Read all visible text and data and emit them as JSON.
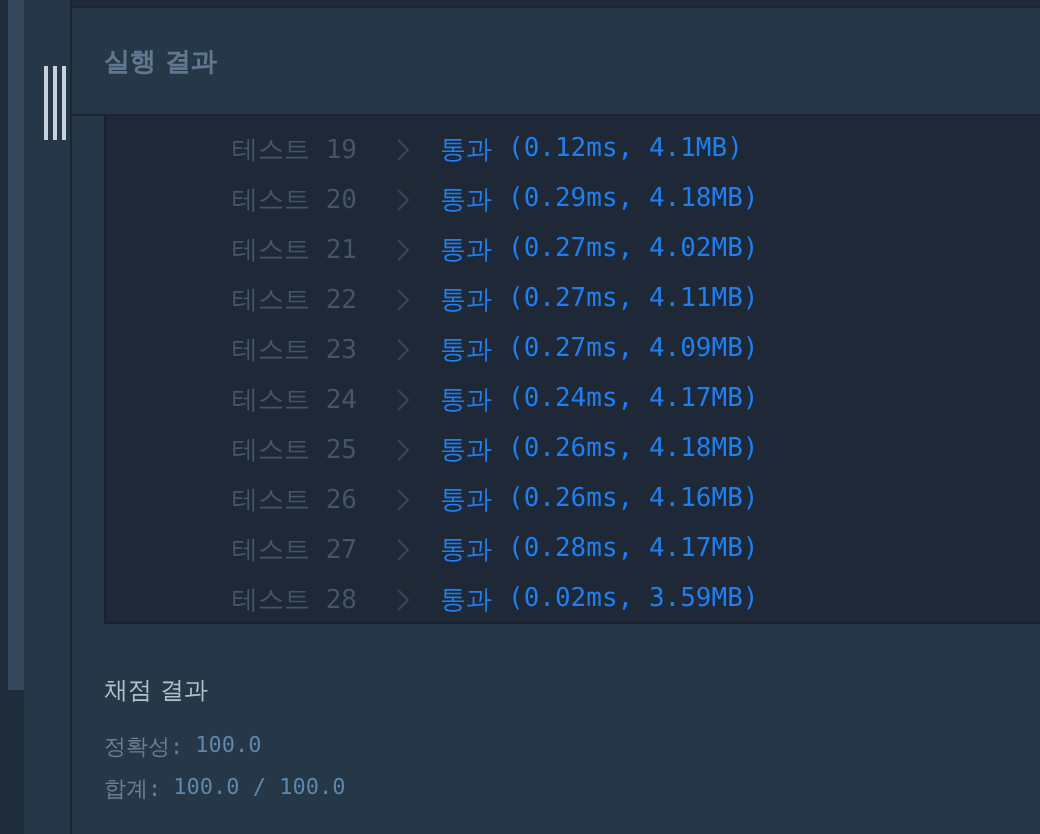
{
  "panel": {
    "title": "실행 결과"
  },
  "tests": [
    {
      "label": "테스트 19",
      "status": "통과",
      "detail": "(0.12ms, 4.1MB)",
      "passed": true
    },
    {
      "label": "테스트 20",
      "status": "통과",
      "detail": "(0.29ms, 4.18MB)",
      "passed": true
    },
    {
      "label": "테스트 21",
      "status": "통과",
      "detail": "(0.27ms, 4.02MB)",
      "passed": true
    },
    {
      "label": "테스트 22",
      "status": "통과",
      "detail": "(0.27ms, 4.11MB)",
      "passed": true
    },
    {
      "label": "테스트 23",
      "status": "통과",
      "detail": "(0.27ms, 4.09MB)",
      "passed": true
    },
    {
      "label": "테스트 24",
      "status": "통과",
      "detail": "(0.24ms, 4.17MB)",
      "passed": true
    },
    {
      "label": "테스트 25",
      "status": "통과",
      "detail": "(0.26ms, 4.18MB)",
      "passed": true
    },
    {
      "label": "테스트 26",
      "status": "통과",
      "detail": "(0.26ms, 4.16MB)",
      "passed": true
    },
    {
      "label": "테스트 27",
      "status": "통과",
      "detail": "(0.28ms, 4.17MB)",
      "passed": true
    },
    {
      "label": "테스트 28",
      "status": "통과",
      "detail": "(0.02ms, 3.59MB)",
      "passed": true
    }
  ],
  "grading": {
    "title": "채점 결과",
    "lines": [
      {
        "label": "정확성:",
        "value": "100.0"
      },
      {
        "label": "합계:",
        "value": "100.0 / 100.0"
      }
    ]
  }
}
